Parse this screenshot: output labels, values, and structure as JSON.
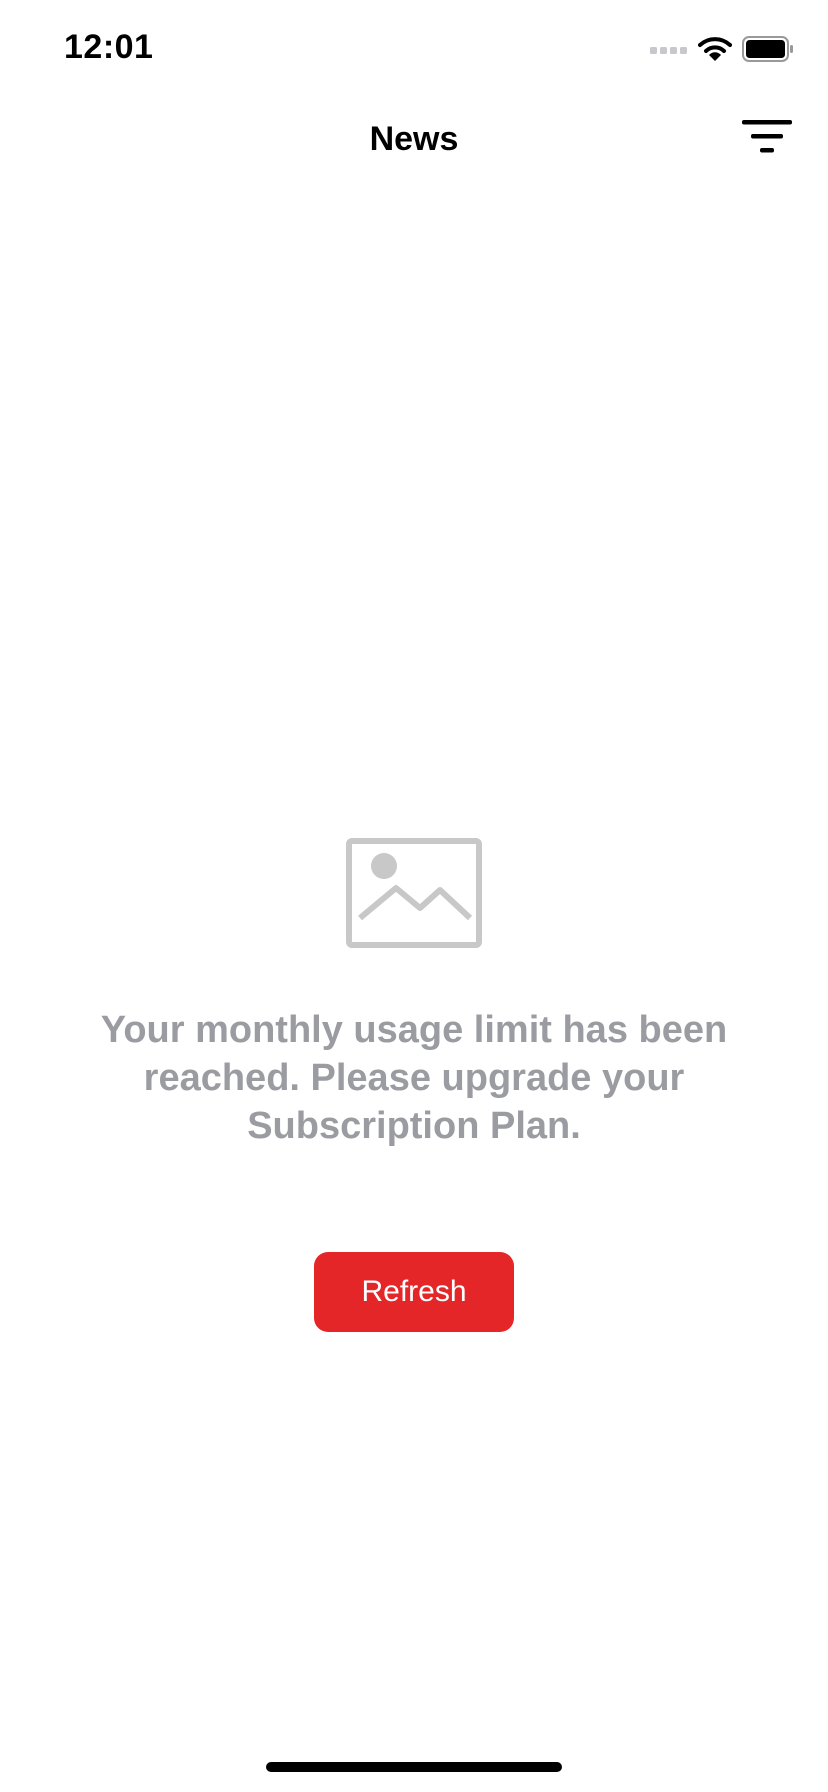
{
  "status_bar": {
    "time": "12:01",
    "icons": [
      "cellular-signal-icon",
      "wifi-icon",
      "battery-icon"
    ]
  },
  "header": {
    "title": "News",
    "filter_icon": "filter-icon"
  },
  "empty_state": {
    "icon": "image-placeholder-icon",
    "message": "Your monthly usage limit has been reached. Please upgrade your Subscription Plan.",
    "refresh_label": "Refresh"
  },
  "colors": {
    "accent": "#e52628",
    "message_text": "#9a9ca1",
    "placeholder_icon": "#c8c8c8"
  }
}
